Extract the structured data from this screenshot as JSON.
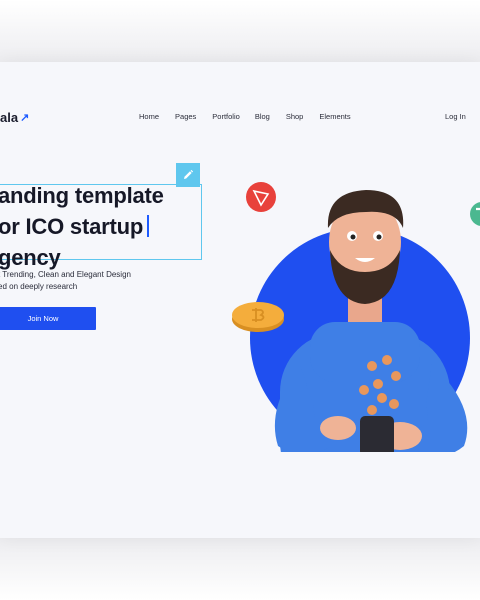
{
  "brand": {
    "logo_text": "ala",
    "logo_arrow": "↗",
    "accent": "#1f5cff"
  },
  "nav": {
    "items": [
      "Home",
      "Pages",
      "Portfolio",
      "Blog",
      "Shop",
      "Elements"
    ],
    "login": "Log In"
  },
  "hero": {
    "headline_lines": [
      "anding template",
      "or ICO startup",
      "gency"
    ],
    "subtitle_lines": [
      "t Trending, Clean and Elegant Design",
      "ed on deeply research"
    ],
    "cta_label": "Join Now"
  },
  "icons": [
    "edit-icon",
    "tron-coin-icon",
    "bitcoin-coin-icon",
    "tether-coin-icon"
  ],
  "colors": {
    "circle": "#1f4ff0",
    "selection": "#5fc7ee",
    "button": "#1f4ff0"
  }
}
